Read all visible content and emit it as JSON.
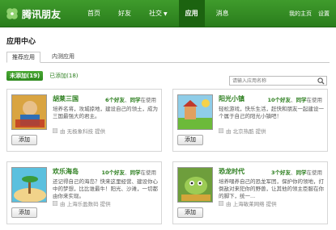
{
  "header": {
    "logo_text": "腾讯朋友",
    "nav": [
      "首页",
      "好友",
      "社交",
      "应用",
      "消息"
    ],
    "right_links": [
      "我的主页",
      "设置"
    ]
  },
  "page_title": "应用中心",
  "tabs": [
    "推荐应用",
    "内测应用"
  ],
  "filters": {
    "not_added": "未添加(19)",
    "added": "已添加(18)"
  },
  "search": {
    "placeholder": "请输入应用名称"
  },
  "cards": [
    {
      "name": "胡莱三国",
      "friends_count": "6个好友",
      "friends_suffix": "同学",
      "using": "在使用",
      "desc": "培养名将，攻城掠地，建设自己的领土，成为三国最强大的君主。",
      "provider": "由 无极象科技 提供",
      "add": "添加",
      "thumb": "胡莱三国"
    },
    {
      "name": "阳光小镇",
      "friends_count": "10个好友",
      "friends_suffix": "同学",
      "using": "在使用",
      "desc": "轻松游戏，快乐生活，赶快和朋友一起建设一个属于自己的阳光小镇吧！",
      "provider": "由 北京热酷 提供",
      "add": "添加",
      "thumb": "阳光小镇"
    },
    {
      "name": "欢乐海岛",
      "friends_count": "10个好友",
      "friends_suffix": "同学",
      "using": "在使用",
      "desc": "还记得自己的海岛？快来这里经营、建设你心中的梦想，比比谁最牛！阳光、沙滩，一切都由你来实现。",
      "provider": "由 上海乐盈数码 提供",
      "add": "添加",
      "thumb": "欢乐海岛"
    },
    {
      "name": "恐龙时代",
      "friends_count": "3个好友",
      "friends_suffix": "同学",
      "using": "在使用",
      "desc": "培养喂养自己的恐龙军团，保护你的领地，打倒敌对来犯你的野兽，让其他的领主臣服在你的脚下，统一...",
      "provider": "由 上海敏莱网络 提供",
      "add": "添加",
      "thumb": "恐龙时代"
    }
  ],
  "colors": {
    "brand_green": "#2a7d1c",
    "header_green": "#3f9b2c"
  }
}
